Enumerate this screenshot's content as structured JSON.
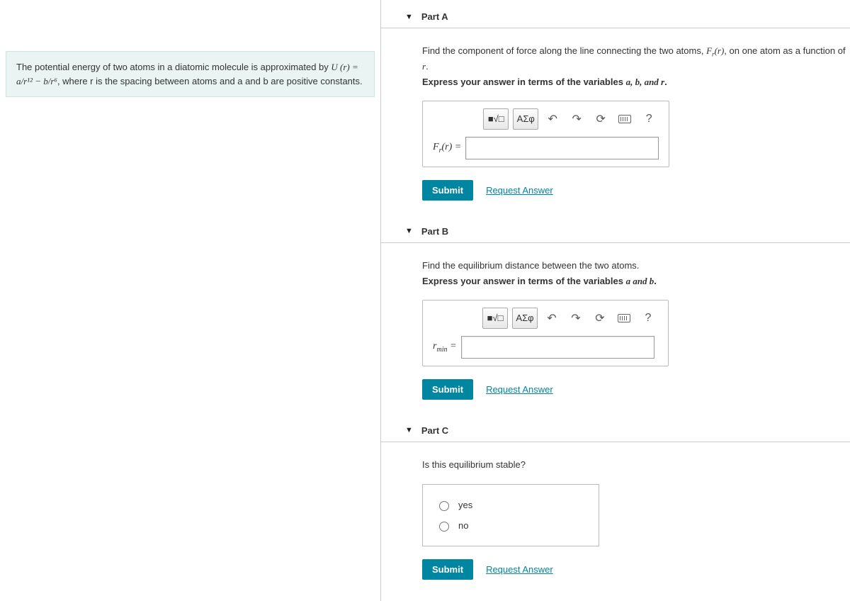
{
  "problem": {
    "text_before": "The potential energy of two atoms in a diatomic molecule is approximated by ",
    "equation": "U (r) = a/r¹² − b/r⁶",
    "text_after": ", where r is the spacing between atoms and a and b are positive constants."
  },
  "parts": [
    {
      "title": "Part A",
      "prompt_segments": [
        "Find the component of force along the line connecting the two atoms, ",
        "F",
        "r",
        "(r)",
        ", on one atom as a function of ",
        "r",
        "."
      ],
      "instruction_prefix": "Express your answer in terms of the variables ",
      "instruction_vars": "a, b, and r",
      "instruction_suffix": ".",
      "input_label_html": "F<sub>r</sub>(r) =",
      "toolbar": {
        "templates": "■√□",
        "greek": "ΑΣφ",
        "undo": "↶",
        "redo": "↷",
        "reset": "⟳",
        "help": "?"
      },
      "submit": "Submit",
      "request": "Request Answer"
    },
    {
      "title": "Part B",
      "prompt": "Find the equilibrium distance between the two atoms.",
      "instruction_prefix": "Express your answer in terms of the variables ",
      "instruction_vars": "a and b",
      "instruction_suffix": ".",
      "input_label_html": "r<sub>min</sub> =",
      "toolbar": {
        "templates": "■√□",
        "greek": "ΑΣφ",
        "undo": "↶",
        "redo": "↷",
        "reset": "⟳",
        "help": "?"
      },
      "submit": "Submit",
      "request": "Request Answer"
    },
    {
      "title": "Part C",
      "prompt": "Is this equilibrium stable?",
      "options": [
        "yes",
        "no"
      ],
      "submit": "Submit",
      "request": "Request Answer"
    }
  ]
}
